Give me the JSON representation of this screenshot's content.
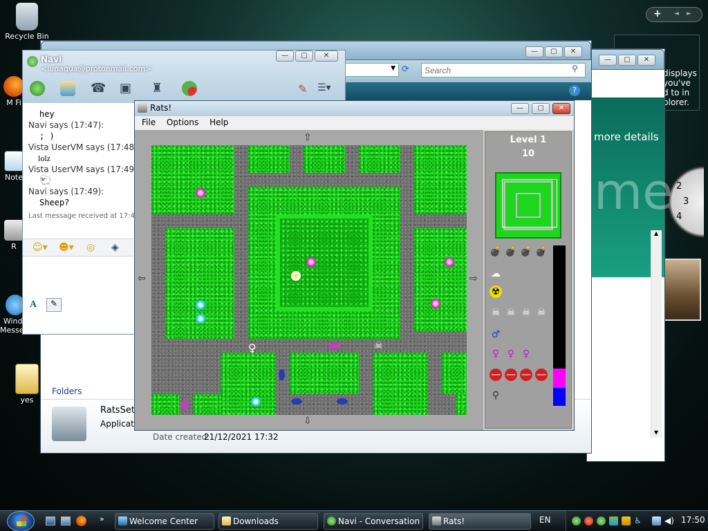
{
  "desktop": {
    "icons": [
      {
        "label": "Recycle Bin"
      },
      {
        "label": "M Fi"
      },
      {
        "label": "Note"
      },
      {
        "label": "R"
      },
      {
        "label": "Windo Messeng"
      },
      {
        "label": "yes"
      }
    ],
    "gadget_text": "displays\nyou've\nd to in\nplorer.",
    "sidebar_plus": "+"
  },
  "welcome_window": {
    "more_details": "more details",
    "brand_fragment": "me"
  },
  "explorer": {
    "search_placeholder": "Search",
    "folders_label": "Folders",
    "file_name": "RatsSetu",
    "file_type": "Applicati",
    "date_created_label": "Date created:",
    "date_created_value": "21/12/2021 17:32"
  },
  "messenger": {
    "title": "Navi",
    "email": "<lunaqua@protonmail.com>",
    "messages": [
      {
        "text": "hey",
        "mono": true
      },
      {
        "text": "Navi says (17:47):",
        "mono": false
      },
      {
        "text": "; )",
        "mono": true
      },
      {
        "text": "Vista UserVM says (17:48",
        "mono": false
      },
      {
        "text": "lolz",
        "mono": false
      },
      {
        "text": "Vista UserVM says (17:49",
        "mono": false
      },
      {
        "text": "sheep-emoticon",
        "mono": false,
        "icon": true
      },
      {
        "text": "Navi says (17:49):",
        "mono": false
      },
      {
        "text": "Sheep?",
        "mono": true
      }
    ],
    "last_message": "Last message received at 17:4",
    "font_button": "A"
  },
  "rats": {
    "title": "Rats!",
    "menu": [
      "File",
      "Options",
      "Help"
    ],
    "level_label": "Level 1",
    "score": "10",
    "inventory": {
      "bombs": 4,
      "gas": 1,
      "radiation": 1,
      "poison": 4,
      "male_change": 1,
      "female_change": 3,
      "stop_signs": 4,
      "hose": 1
    },
    "population_female_fraction": 0.12,
    "population_male_fraction": 0.11,
    "colors": {
      "grass": "#1ed61e",
      "road": "#6f6f6f",
      "female_bar": "#ff00ff",
      "male_bar": "#0000ff"
    }
  },
  "taskbar": {
    "buttons": [
      {
        "label": "Welcome Center",
        "active": false
      },
      {
        "label": "Downloads",
        "active": false
      },
      {
        "label": "Navi - Conversation",
        "active": false
      },
      {
        "label": "Rats!",
        "active": true
      }
    ],
    "language": "EN",
    "clock": "17:50",
    "overflow": "»"
  }
}
